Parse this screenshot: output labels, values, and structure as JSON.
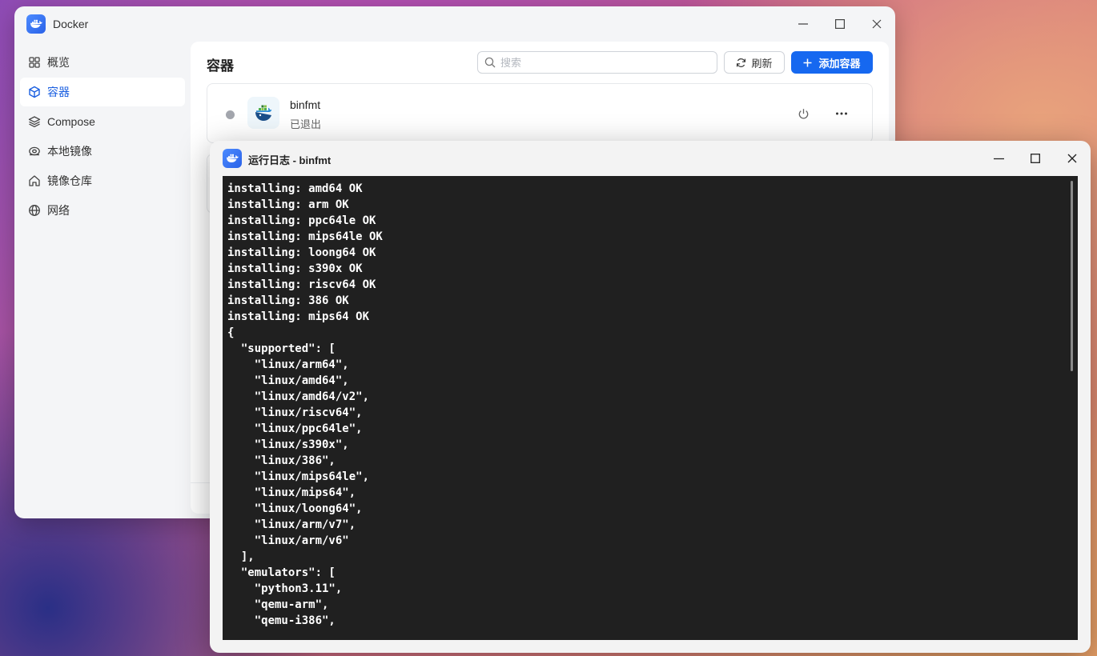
{
  "app": {
    "title": "Docker",
    "sidebar": {
      "items": [
        {
          "label": "概览",
          "icon": "grid-icon",
          "active": false
        },
        {
          "label": "容器",
          "icon": "cube-icon",
          "active": true
        },
        {
          "label": "Compose",
          "icon": "layers-icon",
          "active": false
        },
        {
          "label": "本地镜像",
          "icon": "disc-icon",
          "active": false
        },
        {
          "label": "镜像仓库",
          "icon": "home-icon",
          "active": false
        },
        {
          "label": "网络",
          "icon": "globe-icon",
          "active": false
        }
      ]
    },
    "main": {
      "title": "容器",
      "search_placeholder": "搜索",
      "refresh_label": "刷新",
      "add_label": "添加容器",
      "containers": [
        {
          "name": "binfmt",
          "status": "已退出"
        }
      ]
    }
  },
  "log_window": {
    "title": "运行日志 - binfmt",
    "lines": [
      "installing: amd64 OK",
      "installing: arm OK",
      "installing: ppc64le OK",
      "installing: mips64le OK",
      "installing: loong64 OK",
      "installing: s390x OK",
      "installing: riscv64 OK",
      "installing: 386 OK",
      "installing: mips64 OK",
      "{",
      "  \"supported\": [",
      "    \"linux/arm64\",",
      "    \"linux/amd64\",",
      "    \"linux/amd64/v2\",",
      "    \"linux/riscv64\",",
      "    \"linux/ppc64le\",",
      "    \"linux/s390x\",",
      "    \"linux/386\",",
      "    \"linux/mips64le\",",
      "    \"linux/mips64\",",
      "    \"linux/loong64\",",
      "    \"linux/arm/v7\",",
      "    \"linux/arm/v6\"",
      "  ],",
      "  \"emulators\": [",
      "    \"python3.11\",",
      "    \"qemu-arm\",",
      "    \"qemu-i386\","
    ]
  },
  "colors": {
    "accent": "#1668f0",
    "active_nav_text": "#1a5fe0",
    "terminal_bg": "#202020",
    "terminal_text": "#ffffff",
    "status_exited": "#a3a6ad"
  }
}
